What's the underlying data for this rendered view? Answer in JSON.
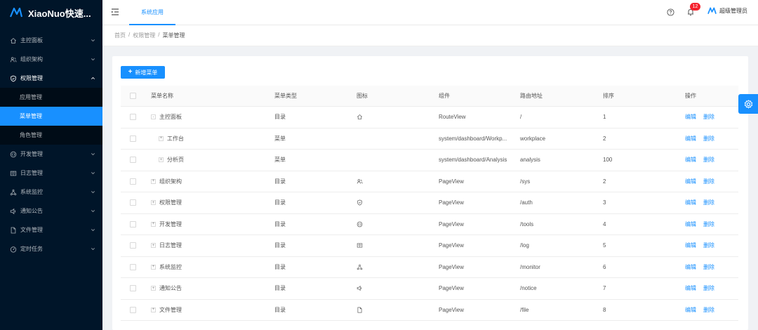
{
  "app": {
    "title": "XiaoNuo快速...",
    "brand_color": "#1890ff",
    "sidebar_bg": "#001529"
  },
  "sidebar": {
    "items": [
      {
        "label": "主控面板",
        "icon": "home-icon"
      },
      {
        "label": "组织架构",
        "icon": "users-icon"
      },
      {
        "label": "权限管理",
        "icon": "shield-icon",
        "open": true,
        "children": [
          {
            "label": "应用管理"
          },
          {
            "label": "菜单管理",
            "active": true
          },
          {
            "label": "角色管理"
          }
        ]
      },
      {
        "label": "开发管理",
        "icon": "code-icon"
      },
      {
        "label": "日志管理",
        "icon": "log-icon"
      },
      {
        "label": "系统监控",
        "icon": "cluster-icon"
      },
      {
        "label": "通知公告",
        "icon": "sound-icon"
      },
      {
        "label": "文件管理",
        "icon": "file-icon"
      },
      {
        "label": "定时任务",
        "icon": "dashboard-icon"
      }
    ]
  },
  "header": {
    "tab": "系统应用",
    "notification_count": "12",
    "user_name": "超级管理员"
  },
  "breadcrumb": [
    "首页",
    "权限管理",
    "菜单管理"
  ],
  "toolbar": {
    "add_label": "新增菜单"
  },
  "table": {
    "columns": [
      "菜单名称",
      "菜单类型",
      "图标",
      "组件",
      "路由地址",
      "排序",
      "操作"
    ],
    "edit_label": "编辑",
    "delete_label": "删除",
    "rows": [
      {
        "expander": "-",
        "indent": 0,
        "name": "主控面板",
        "type": "目录",
        "icon": "home-icon",
        "component": "RouteView",
        "path": "/",
        "sort": "1"
      },
      {
        "expander": "+",
        "indent": 1,
        "name": "工作台",
        "type": "菜单",
        "icon": "",
        "component": "system/dashboard/Workp...",
        "path": "workplace",
        "sort": "2"
      },
      {
        "expander": "+",
        "indent": 1,
        "name": "分析页",
        "type": "菜单",
        "icon": "",
        "component": "system/dashboard/Analysis",
        "path": "analysis",
        "sort": "100"
      },
      {
        "expander": "+",
        "indent": 0,
        "name": "组织架构",
        "type": "目录",
        "icon": "users-icon",
        "component": "PageView",
        "path": "/sys",
        "sort": "2"
      },
      {
        "expander": "+",
        "indent": 0,
        "name": "权限管理",
        "type": "目录",
        "icon": "shield-icon",
        "component": "PageView",
        "path": "/auth",
        "sort": "3"
      },
      {
        "expander": "+",
        "indent": 0,
        "name": "开发管理",
        "type": "目录",
        "icon": "code-icon",
        "component": "PageView",
        "path": "/tools",
        "sort": "4"
      },
      {
        "expander": "+",
        "indent": 0,
        "name": "日志管理",
        "type": "目录",
        "icon": "log-icon",
        "component": "PageView",
        "path": "/log",
        "sort": "5"
      },
      {
        "expander": "+",
        "indent": 0,
        "name": "系统监控",
        "type": "目录",
        "icon": "cluster-icon",
        "component": "PageView",
        "path": "/monitor",
        "sort": "6"
      },
      {
        "expander": "+",
        "indent": 0,
        "name": "通知公告",
        "type": "目录",
        "icon": "sound-icon",
        "component": "PageView",
        "path": "/notice",
        "sort": "7"
      },
      {
        "expander": "+",
        "indent": 0,
        "name": "文件管理",
        "type": "目录",
        "icon": "file-icon",
        "component": "PageView",
        "path": "/file",
        "sort": "8"
      }
    ]
  }
}
